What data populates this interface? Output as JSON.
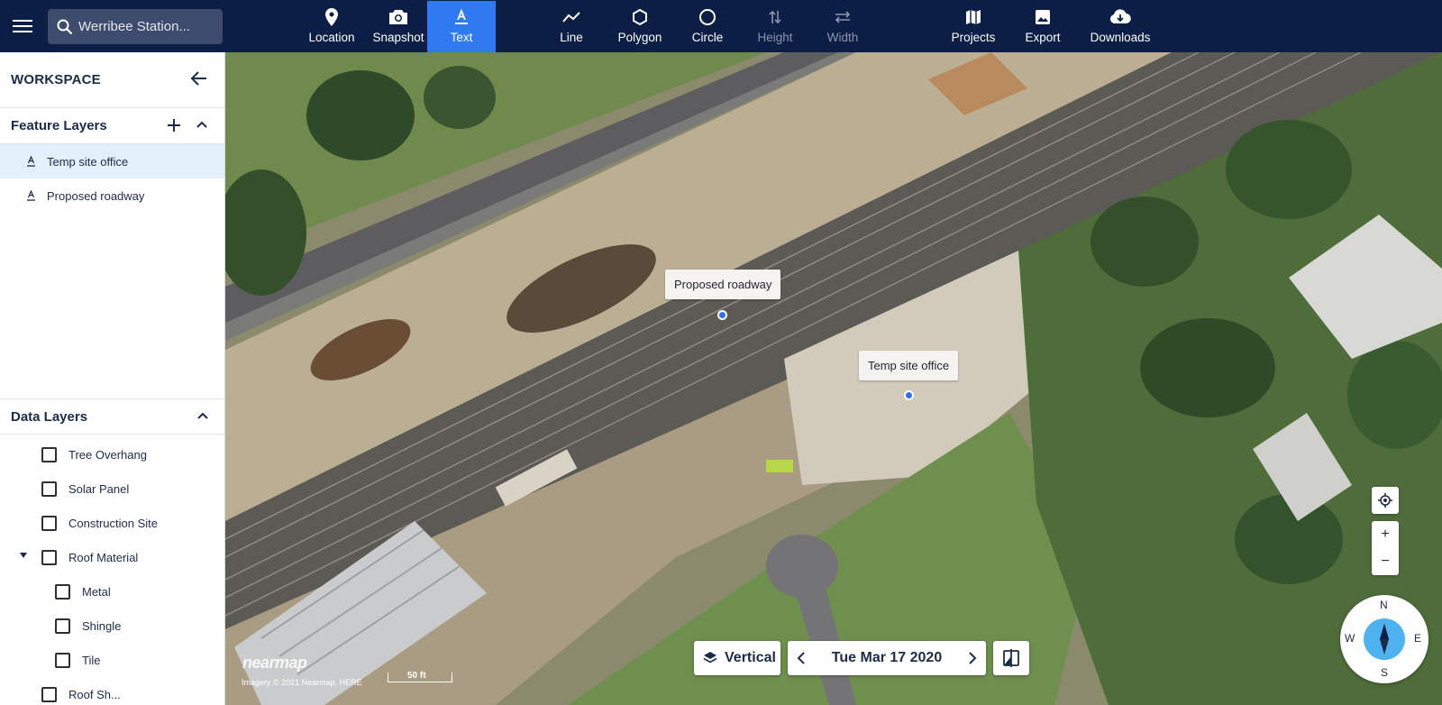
{
  "search": {
    "placeholder": "Werribee Station..."
  },
  "toolbar": {
    "tools": [
      {
        "label": "Location",
        "icon": "pin-icon"
      },
      {
        "label": "Snapshot",
        "icon": "camera-icon"
      },
      {
        "label": "Text",
        "icon": "text-icon",
        "active": true
      },
      {
        "label": "Line",
        "icon": "line-icon"
      },
      {
        "label": "Polygon",
        "icon": "polygon-icon"
      },
      {
        "label": "Circle",
        "icon": "circle-icon"
      },
      {
        "label": "Height",
        "icon": "height-icon",
        "disabled": true
      },
      {
        "label": "Width",
        "icon": "width-icon",
        "disabled": true
      },
      {
        "label": "Projects",
        "icon": "map-icon"
      },
      {
        "label": "Export",
        "icon": "image-icon"
      },
      {
        "label": "Downloads",
        "icon": "cloud-download-icon"
      }
    ]
  },
  "sidebar": {
    "title": "WORKSPACE",
    "feature_layers": {
      "title": "Feature Layers",
      "items": [
        {
          "label": "Temp site office",
          "selected": true
        },
        {
          "label": "Proposed roadway",
          "selected": false
        }
      ]
    },
    "data_layers": {
      "title": "Data Layers",
      "items": [
        {
          "label": "Tree Overhang",
          "checked": false
        },
        {
          "label": "Solar Panel",
          "checked": false
        },
        {
          "label": "Construction Site",
          "checked": false
        },
        {
          "label": "Roof Material",
          "checked": false,
          "expanded": true
        },
        {
          "label": "Metal",
          "checked": false
        },
        {
          "label": "Shingle",
          "checked": false
        },
        {
          "label": "Tile",
          "checked": false
        },
        {
          "label": "Roof Sh...",
          "checked": false
        }
      ]
    }
  },
  "map": {
    "labels": [
      {
        "text": "Proposed roadway"
      },
      {
        "text": "Temp site office"
      }
    ],
    "view_mode": "Vertical",
    "date": "Tue Mar 17 2020",
    "compass": {
      "n": "N",
      "e": "E",
      "s": "S",
      "w": "W"
    },
    "logo": "nearmap",
    "attribution": "Imagery © 2021 Nearmap, HERE",
    "scale": "50 ft",
    "colors": {
      "accent": "#2f7af0",
      "topbar": "#0c1e45",
      "pin": "#2f6ff0"
    }
  }
}
